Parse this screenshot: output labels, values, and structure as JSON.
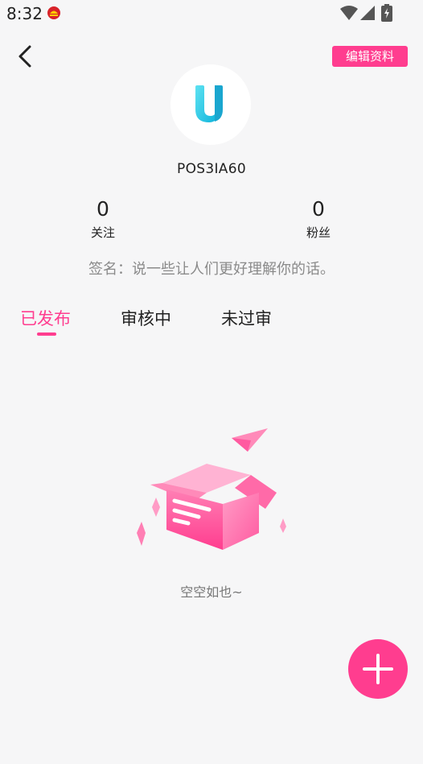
{
  "status_bar": {
    "time": "8:32",
    "icons": [
      "app-notification-icon",
      "wifi-icon",
      "cell-signal-icon",
      "battery-icon"
    ]
  },
  "header": {
    "back_icon": "chevron-left-icon",
    "edit_label": "编辑资料"
  },
  "profile": {
    "avatar_icon": "u-logo-icon",
    "username": "POS3IA60",
    "following_count": "0",
    "following_label": "关注",
    "fans_count": "0",
    "fans_label": "粉丝",
    "signature": "签名：说一些让人们更好理解你的话。"
  },
  "tabs": [
    {
      "label": "已发布",
      "active": true
    },
    {
      "label": "审核中",
      "active": false
    },
    {
      "label": "未过审",
      "active": false
    }
  ],
  "empty_state": {
    "illustration": "empty-box-icon",
    "text": "空空如也~"
  },
  "fab": {
    "icon": "plus-icon"
  },
  "colors": {
    "accent": "#ff3d8f",
    "background": "#f6f6f7",
    "logo_cyan": "#25c9e6"
  }
}
